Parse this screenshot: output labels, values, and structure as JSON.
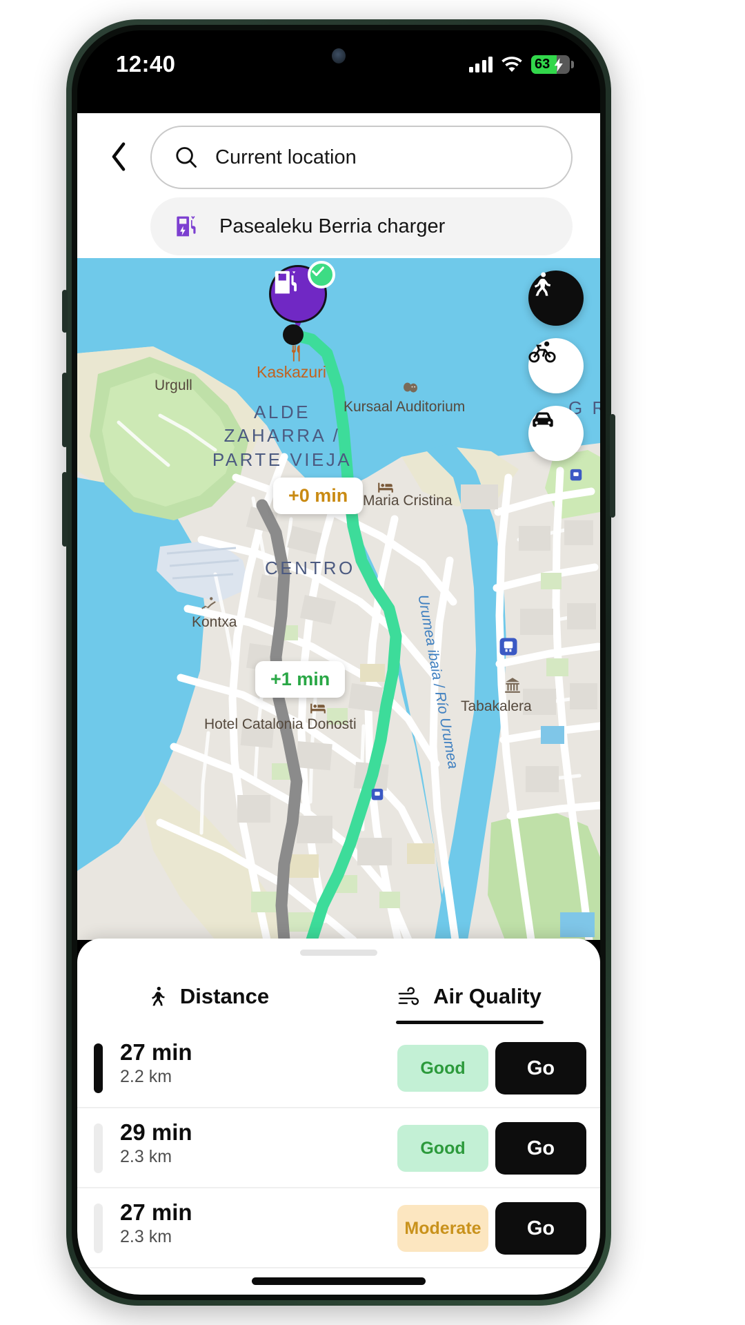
{
  "status_bar": {
    "time": "12:40",
    "battery_percent": "63",
    "battery_charging": true,
    "signal_icon": "cellular-signal-icon",
    "wifi_icon": "wifi-icon",
    "battery_icon": "battery-icon"
  },
  "header": {
    "back_icon": "back-chevron-icon",
    "search": {
      "icon": "search-icon",
      "value": "Current location",
      "placeholder": "Current location"
    },
    "destination": {
      "icon": "ev-charger-icon",
      "label": "Pasealeku Berria charger"
    }
  },
  "map": {
    "destination_pin": {
      "icon": "ev-charger-pin-icon",
      "badge_icon": "check-circle-icon"
    },
    "origin_marker": "origin-dot",
    "route_chips": [
      {
        "label": "+0 min",
        "tone": "amber"
      },
      {
        "label": "+1 min",
        "tone": "green"
      }
    ],
    "mode_buttons": [
      {
        "name": "walk",
        "icon": "walking-person-icon",
        "active": true
      },
      {
        "name": "bike",
        "icon": "bicycle-icon",
        "active": false
      },
      {
        "name": "car",
        "icon": "car-icon",
        "active": false
      }
    ],
    "labels": {
      "urgull": "Urgull",
      "kaskazuri": "Kaskazuri",
      "alde_zaharra": "ALDE\nZAHARRA /\nPARTE VIEJA",
      "kursaal": "Kursaal Auditorium",
      "maria_cristina": "Maria Cristina",
      "centro": "CENTRO",
      "kontxa": "Kontxa",
      "tabakalera": "Tabakalera",
      "hotel": "Hotel Catalonia Donosti",
      "river": "Urumea ibaia / Río Urumea",
      "gros": "G R"
    }
  },
  "sheet": {
    "grabber": "sheet-grabber",
    "tabs": [
      {
        "label": "Distance",
        "icon": "walking-person-icon",
        "active": false
      },
      {
        "label": "Air Quality",
        "icon": "wind-icon",
        "active": true
      }
    ],
    "go_label": "Go",
    "routes": [
      {
        "time": "27 min",
        "distance": "2.2 km",
        "aqi": "Good",
        "aqi_tone": "good",
        "selected": true
      },
      {
        "time": "29 min",
        "distance": "2.3 km",
        "aqi": "Good",
        "aqi_tone": "good",
        "selected": false
      },
      {
        "time": "27 min",
        "distance": "2.3 km",
        "aqi": "Moderate",
        "aqi_tone": "moderate",
        "selected": false
      }
    ]
  },
  "colors": {
    "brand_purple": "#7028c4",
    "route_green": "#3ddc9a",
    "aqi_good_bg": "#c3f0d5",
    "aqi_good_fg": "#2c9a3c",
    "aqi_moderate_bg": "#fce6c0",
    "aqi_moderate_fg": "#c9921c",
    "water": "#6fc9ea",
    "black": "#0d0d0d"
  }
}
